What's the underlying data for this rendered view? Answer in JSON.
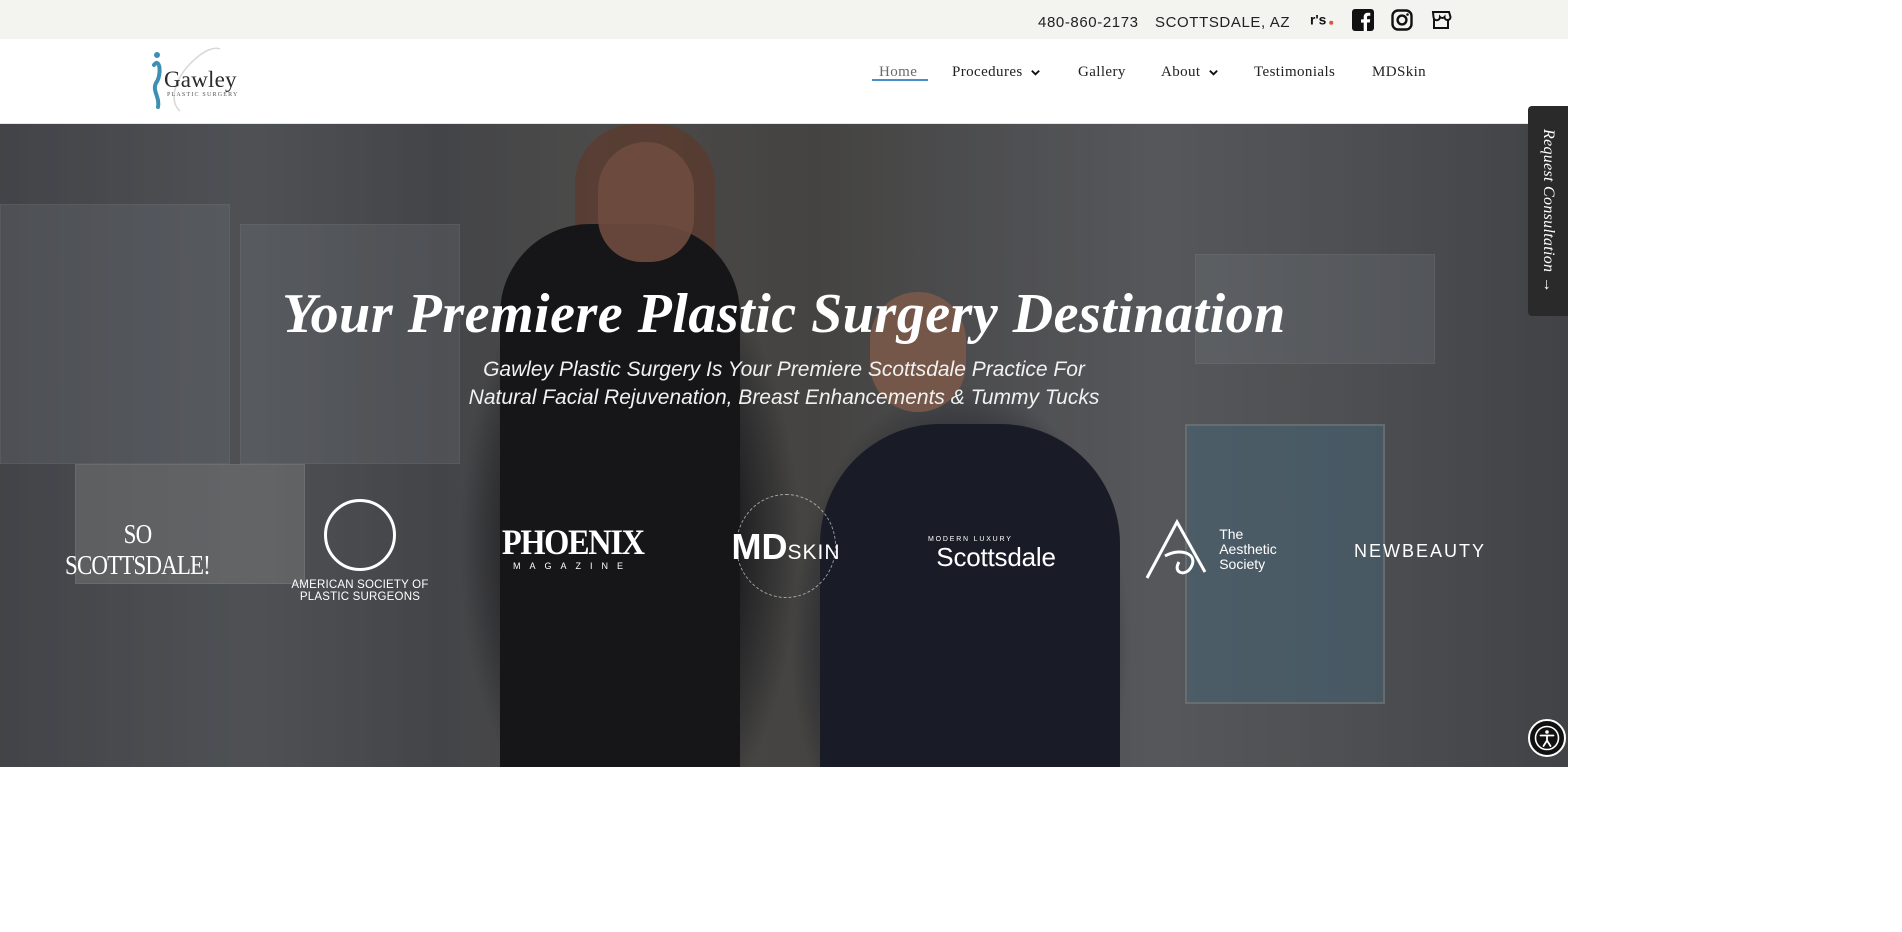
{
  "topbar": {
    "phone": "480-860-2173",
    "location": "SCOTTSDALE, AZ",
    "icons": [
      "realself-icon",
      "facebook-icon",
      "instagram-icon",
      "store-icon"
    ]
  },
  "header": {
    "logo_text": "Gawley",
    "logo_sub": "PLASTIC SURGERY",
    "nav": [
      {
        "label": "Home",
        "has_dropdown": false,
        "active": true
      },
      {
        "label": "Procedures",
        "has_dropdown": true
      },
      {
        "label": "Gallery",
        "has_dropdown": false
      },
      {
        "label": "About",
        "has_dropdown": true
      },
      {
        "label": "Testimonials",
        "has_dropdown": false
      },
      {
        "label": "MDSkin",
        "has_dropdown": false
      }
    ],
    "accent_color": "#4a90c7"
  },
  "hero": {
    "title": "Your Premiere Plastic Surgery Destination",
    "subtitle_line1": "Gawley Plastic Surgery Is Your Premiere Scottsdale Practice For",
    "subtitle_line2": "Natural Facial Rejuvenation, Breast Enhancements & Tummy Tucks",
    "press": {
      "so_scottsdale": "SO SCOTTSDALE!",
      "asps_line1": "AMERICAN SOCIETY OF",
      "asps_line2": "PLASTIC SURGEONS",
      "phoenix": "PHOENIX",
      "phoenix_sub": "MAGAZINE",
      "mdskin_md": "MD",
      "mdskin_skin": "SKIN",
      "lux_top": "MODERN LUXURY",
      "lux_main": "Scottsdale",
      "aes_line1": "The",
      "aes_line2": "Aesthetic",
      "aes_line3": "Society",
      "newbeauty": "NEWBEAUTY"
    }
  },
  "side_tab": {
    "label": "Request Consultation →"
  },
  "accessibility": {
    "icon": "accessibility-icon"
  }
}
